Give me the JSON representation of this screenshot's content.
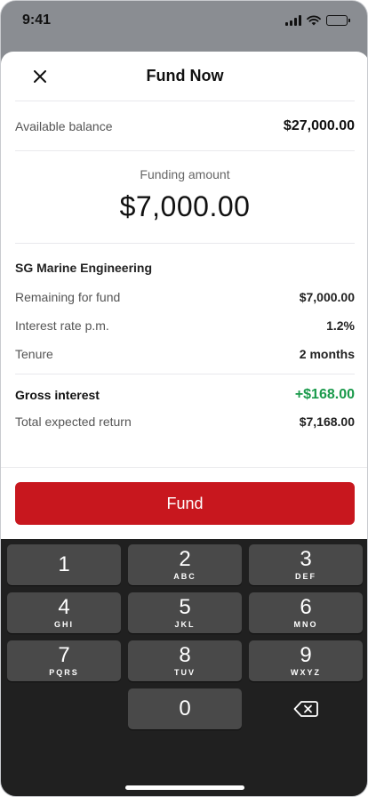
{
  "status_bar": {
    "time": "9:41"
  },
  "header": {
    "title": "Fund Now",
    "close_icon": "close-icon"
  },
  "balance": {
    "label": "Available balance",
    "value": "$27,000.00"
  },
  "funding": {
    "label": "Funding amount",
    "value": "$7,000.00"
  },
  "loan": {
    "company": "SG Marine Engineering",
    "rows": [
      {
        "label": "Remaining for fund",
        "value": "$7,000.00"
      },
      {
        "label": "Interest rate p.m.",
        "value": "1.2%"
      },
      {
        "label": "Tenure",
        "value": "2 months"
      }
    ]
  },
  "summary": {
    "gross_label": "Gross interest",
    "gross_value": "+$168.00",
    "total_label": "Total expected return",
    "total_value": "$7,168.00"
  },
  "fund_button": {
    "label": "Fund"
  },
  "keypad": {
    "keys": [
      {
        "digit": "1",
        "letters": ""
      },
      {
        "digit": "2",
        "letters": "ABC"
      },
      {
        "digit": "3",
        "letters": "DEF"
      },
      {
        "digit": "4",
        "letters": "GHI"
      },
      {
        "digit": "5",
        "letters": "JKL"
      },
      {
        "digit": "6",
        "letters": "MNO"
      },
      {
        "digit": "7",
        "letters": "PQRS"
      },
      {
        "digit": "8",
        "letters": "TUV"
      },
      {
        "digit": "9",
        "letters": "WXYZ"
      },
      {
        "digit": "0",
        "letters": ""
      }
    ],
    "delete_icon": "backspace-icon"
  },
  "colors": {
    "brand_red": "#c8171e",
    "positive_green": "#1a9a4b",
    "keypad_bg": "#202020",
    "key_bg": "#494949"
  }
}
